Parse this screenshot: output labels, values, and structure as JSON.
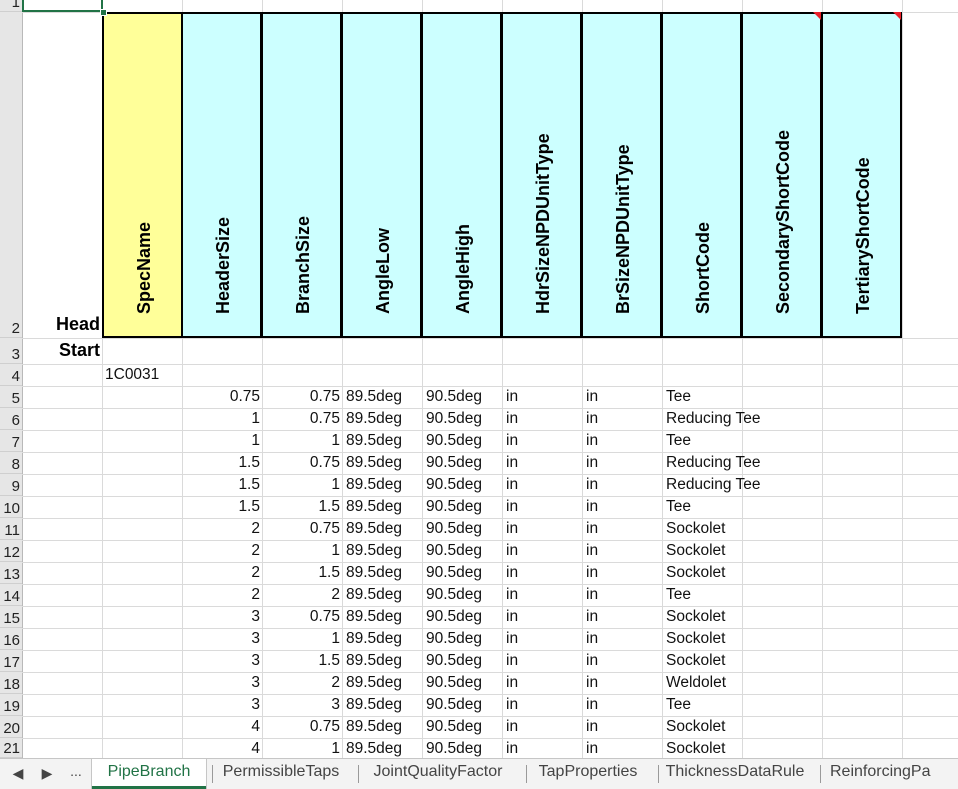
{
  "row_numbers": [
    "1",
    "2",
    "3",
    "4",
    "5",
    "6",
    "7",
    "8",
    "9",
    "10",
    "11",
    "12",
    "13",
    "14",
    "15",
    "16",
    "17",
    "18",
    "19",
    "20",
    "21"
  ],
  "labels": {
    "head": "Head",
    "start": "Start"
  },
  "columns": [
    "SpecName",
    "HeaderSize",
    "BranchSize",
    "AngleLow",
    "AngleHigh",
    "HdrSizeNPDUnitType",
    "BrSizeNPDUnitType",
    "ShortCode",
    "SecondaryShortCode",
    "TertiaryShortCode"
  ],
  "colors": {
    "spec_header": "#ffff99",
    "other_header": "#ccffff",
    "comment_marker": "#e8202a",
    "accent": "#217346"
  },
  "spec_name": "1C0031",
  "rows": [
    {
      "header": "0.75",
      "branch": "0.75",
      "low": "89.5deg",
      "high": "90.5deg",
      "hdr_unit": "in",
      "br_unit": "in",
      "code": "Tee"
    },
    {
      "header": "1",
      "branch": "0.75",
      "low": "89.5deg",
      "high": "90.5deg",
      "hdr_unit": "in",
      "br_unit": "in",
      "code": "Reducing Tee"
    },
    {
      "header": "1",
      "branch": "1",
      "low": "89.5deg",
      "high": "90.5deg",
      "hdr_unit": "in",
      "br_unit": "in",
      "code": "Tee"
    },
    {
      "header": "1.5",
      "branch": "0.75",
      "low": "89.5deg",
      "high": "90.5deg",
      "hdr_unit": "in",
      "br_unit": "in",
      "code": "Reducing Tee"
    },
    {
      "header": "1.5",
      "branch": "1",
      "low": "89.5deg",
      "high": "90.5deg",
      "hdr_unit": "in",
      "br_unit": "in",
      "code": "Reducing Tee"
    },
    {
      "header": "1.5",
      "branch": "1.5",
      "low": "89.5deg",
      "high": "90.5deg",
      "hdr_unit": "in",
      "br_unit": "in",
      "code": "Tee"
    },
    {
      "header": "2",
      "branch": "0.75",
      "low": "89.5deg",
      "high": "90.5deg",
      "hdr_unit": "in",
      "br_unit": "in",
      "code": "Sockolet"
    },
    {
      "header": "2",
      "branch": "1",
      "low": "89.5deg",
      "high": "90.5deg",
      "hdr_unit": "in",
      "br_unit": "in",
      "code": "Sockolet"
    },
    {
      "header": "2",
      "branch": "1.5",
      "low": "89.5deg",
      "high": "90.5deg",
      "hdr_unit": "in",
      "br_unit": "in",
      "code": "Sockolet"
    },
    {
      "header": "2",
      "branch": "2",
      "low": "89.5deg",
      "high": "90.5deg",
      "hdr_unit": "in",
      "br_unit": "in",
      "code": "Tee"
    },
    {
      "header": "3",
      "branch": "0.75",
      "low": "89.5deg",
      "high": "90.5deg",
      "hdr_unit": "in",
      "br_unit": "in",
      "code": "Sockolet"
    },
    {
      "header": "3",
      "branch": "1",
      "low": "89.5deg",
      "high": "90.5deg",
      "hdr_unit": "in",
      "br_unit": "in",
      "code": "Sockolet"
    },
    {
      "header": "3",
      "branch": "1.5",
      "low": "89.5deg",
      "high": "90.5deg",
      "hdr_unit": "in",
      "br_unit": "in",
      "code": "Sockolet"
    },
    {
      "header": "3",
      "branch": "2",
      "low": "89.5deg",
      "high": "90.5deg",
      "hdr_unit": "in",
      "br_unit": "in",
      "code": "Weldolet"
    },
    {
      "header": "3",
      "branch": "3",
      "low": "89.5deg",
      "high": "90.5deg",
      "hdr_unit": "in",
      "br_unit": "in",
      "code": "Tee"
    },
    {
      "header": "4",
      "branch": "0.75",
      "low": "89.5deg",
      "high": "90.5deg",
      "hdr_unit": "in",
      "br_unit": "in",
      "code": "Sockolet"
    },
    {
      "header": "4",
      "branch": "1",
      "low": "89.5deg",
      "high": "90.5deg",
      "hdr_unit": "in",
      "br_unit": "in",
      "code": "Sockolet"
    }
  ],
  "tab_nav": {
    "prev": "◀",
    "next": "▶",
    "more": "..."
  },
  "tabs": [
    "PipeBranch",
    "PermissibleTaps",
    "JointQualityFactor",
    "TapProperties",
    "ThicknessDataRule",
    "ReinforcingPa"
  ],
  "active_tab": "PipeBranch"
}
